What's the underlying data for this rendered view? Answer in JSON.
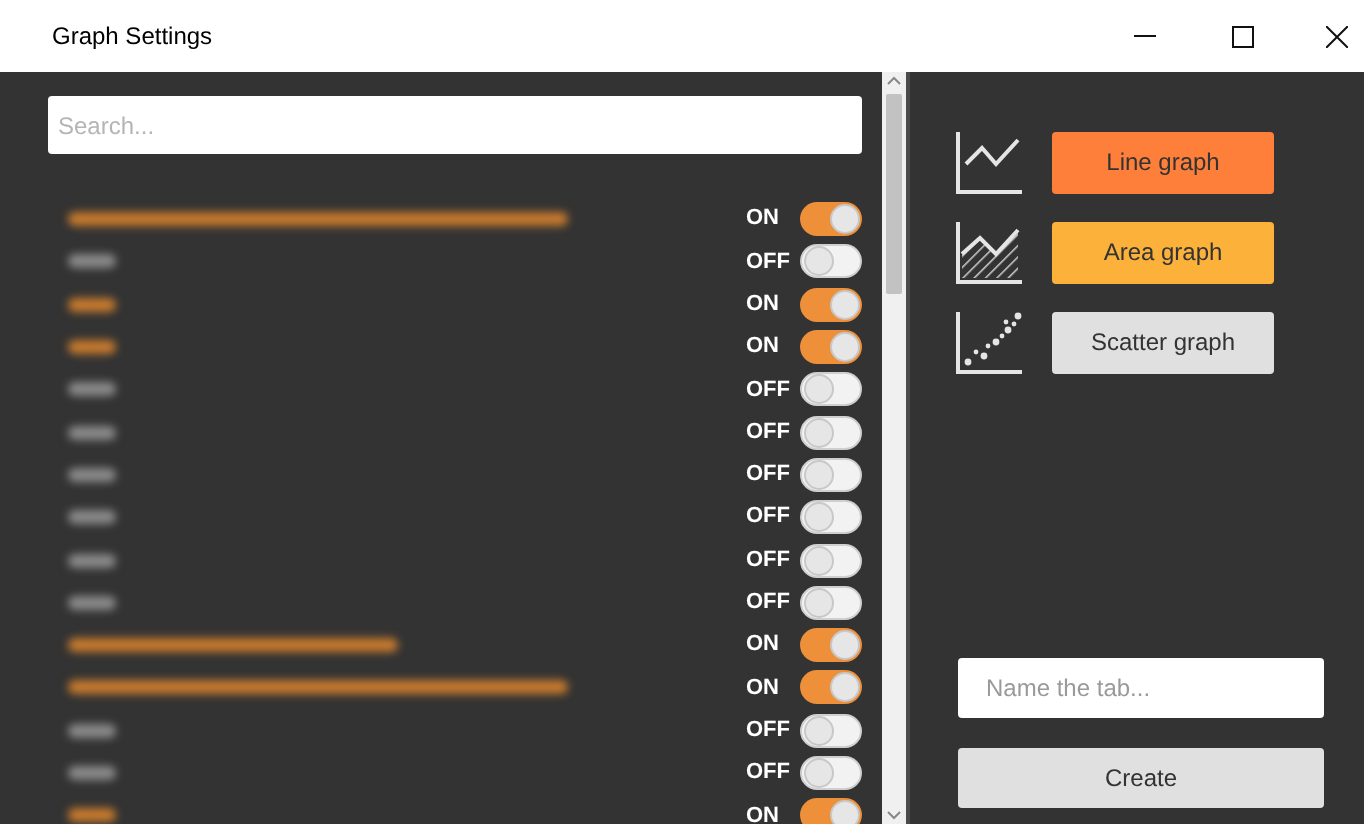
{
  "window": {
    "title": "Graph Settings"
  },
  "search": {
    "placeholder": "Search..."
  },
  "items": [
    {
      "kind": "long",
      "on": true,
      "state_label": "ON"
    },
    {
      "kind": "short",
      "on": false,
      "state_label": "OFF"
    },
    {
      "kind": "short",
      "on": true,
      "state_label": "ON"
    },
    {
      "kind": "short",
      "on": true,
      "state_label": "ON"
    },
    {
      "kind": "short",
      "on": false,
      "state_label": "OFF"
    },
    {
      "kind": "short",
      "on": false,
      "state_label": "OFF"
    },
    {
      "kind": "short",
      "on": false,
      "state_label": "OFF"
    },
    {
      "kind": "short",
      "on": false,
      "state_label": "OFF"
    },
    {
      "kind": "short",
      "on": false,
      "state_label": "OFF"
    },
    {
      "kind": "short",
      "on": false,
      "state_label": "OFF"
    },
    {
      "kind": "medium",
      "on": true,
      "state_label": "ON"
    },
    {
      "kind": "long",
      "on": true,
      "state_label": "ON"
    },
    {
      "kind": "short",
      "on": false,
      "state_label": "OFF"
    },
    {
      "kind": "short",
      "on": false,
      "state_label": "OFF"
    },
    {
      "kind": "short",
      "on": true,
      "state_label": "ON"
    }
  ],
  "graph_types": [
    {
      "kind": "line",
      "label": "Line graph",
      "color": "#fd7f3a"
    },
    {
      "kind": "area",
      "label": "Area graph",
      "color": "#fcb23a"
    },
    {
      "kind": "scatter",
      "label": "Scatter graph",
      "color": "#e0e0e0"
    }
  ],
  "tab_name": {
    "placeholder": "Name the tab..."
  },
  "create_button": "Create"
}
